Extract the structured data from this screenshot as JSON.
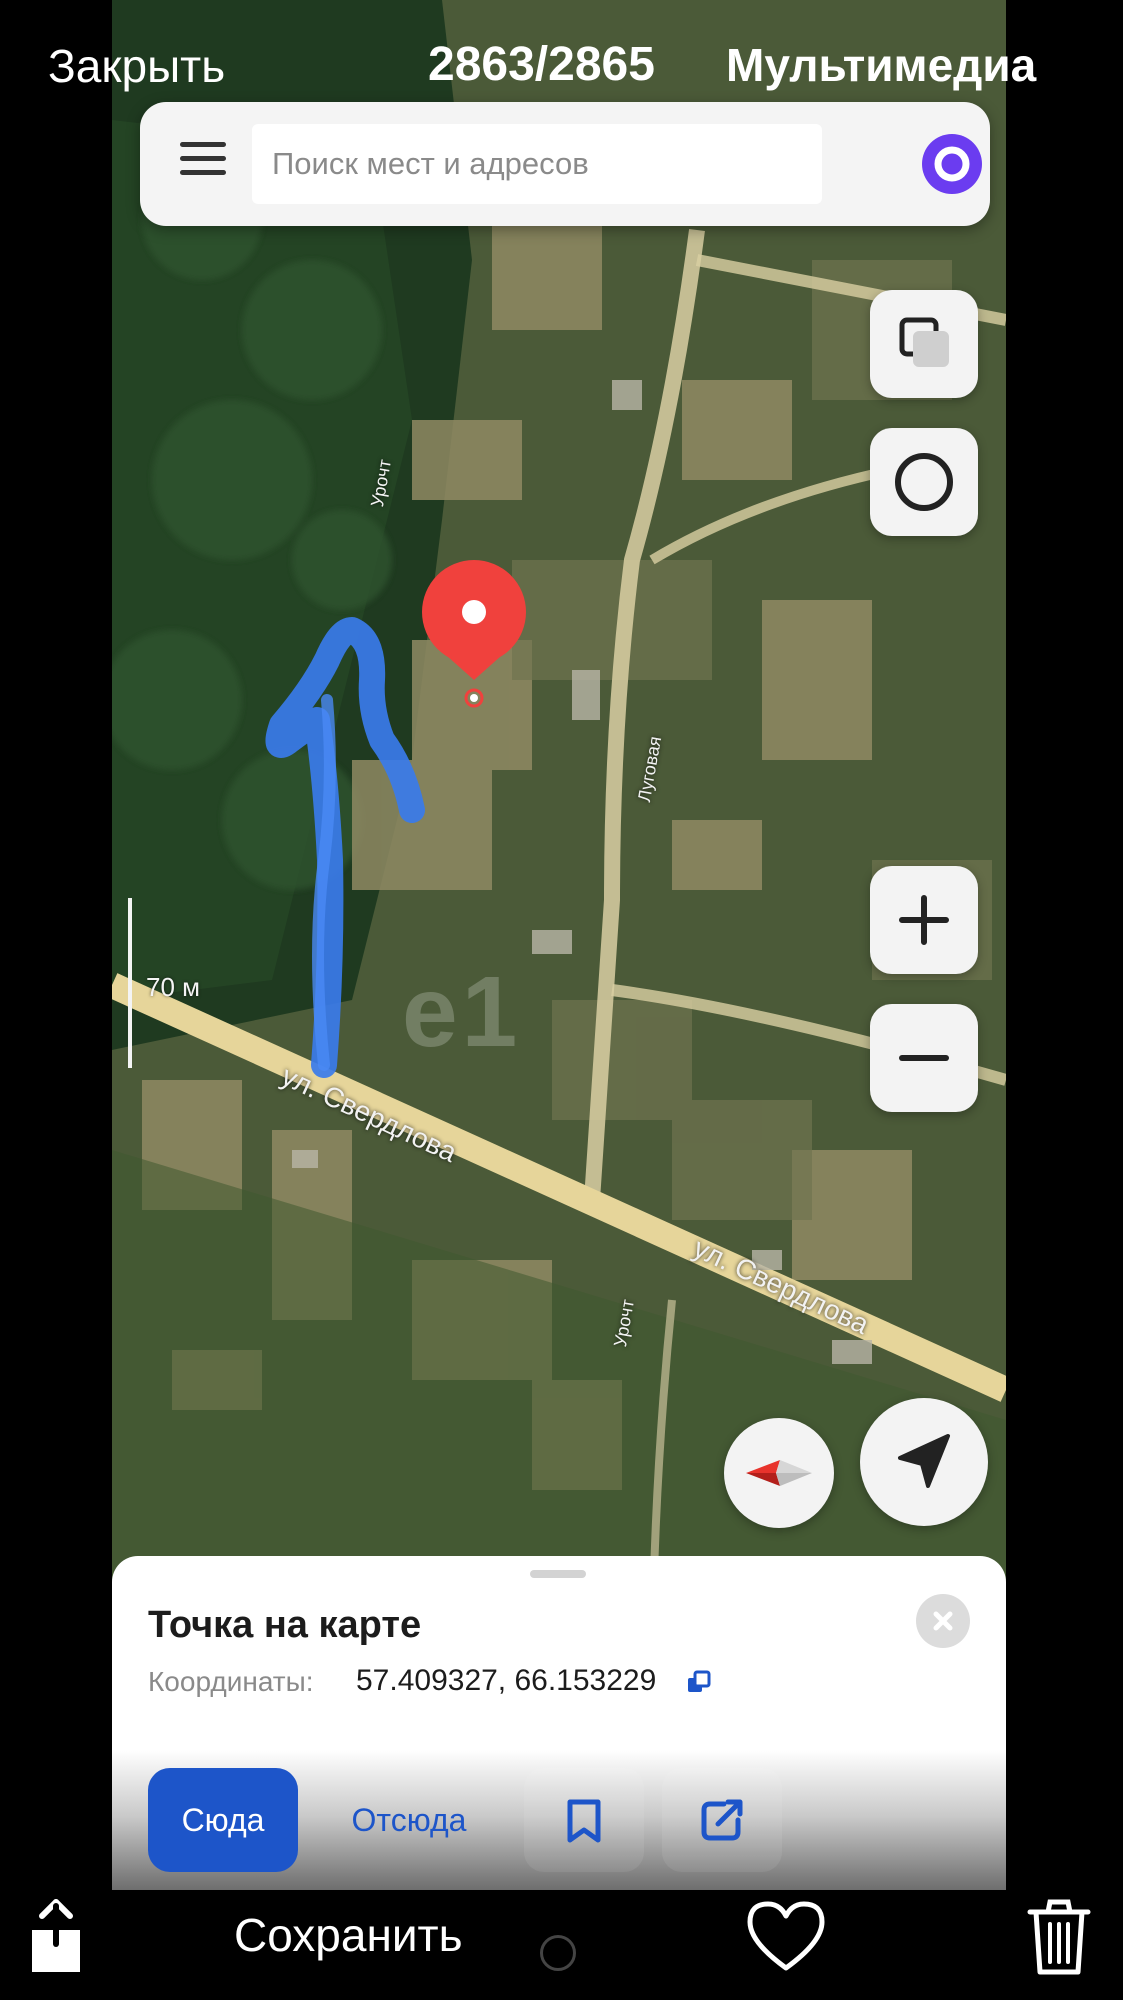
{
  "viewer": {
    "close_label": "Закрыть",
    "counter": "2863/2865",
    "media_label": "Мультимедиа",
    "save_label": "Сохранить"
  },
  "map": {
    "search": {
      "placeholder": "Поиск мест и адресов"
    },
    "scale_label": "70 м",
    "streets": {
      "main_1": "ул. Свердлова",
      "main_2": "ул. Свердлова",
      "side": "Луговая",
      "small_1": "Урочт",
      "small_2": "Урочт"
    },
    "watermark": "e1",
    "colors": {
      "marker": "#f0413d",
      "arrow_drawing": "#3a7bea",
      "primary_button": "#1d55c9",
      "alice": "#6b3cf0"
    },
    "icons": [
      "menu-icon",
      "alice-icon",
      "layers-icon",
      "circle-icon",
      "zoom-in-icon",
      "zoom-out-icon",
      "compass-icon",
      "location-arrow-icon"
    ]
  },
  "sheet": {
    "title": "Точка на карте",
    "coords_label": "Координаты:",
    "coords_value": "57.409327, 66.153229",
    "here_label": "Сюда",
    "from_label": "Отсюда"
  }
}
